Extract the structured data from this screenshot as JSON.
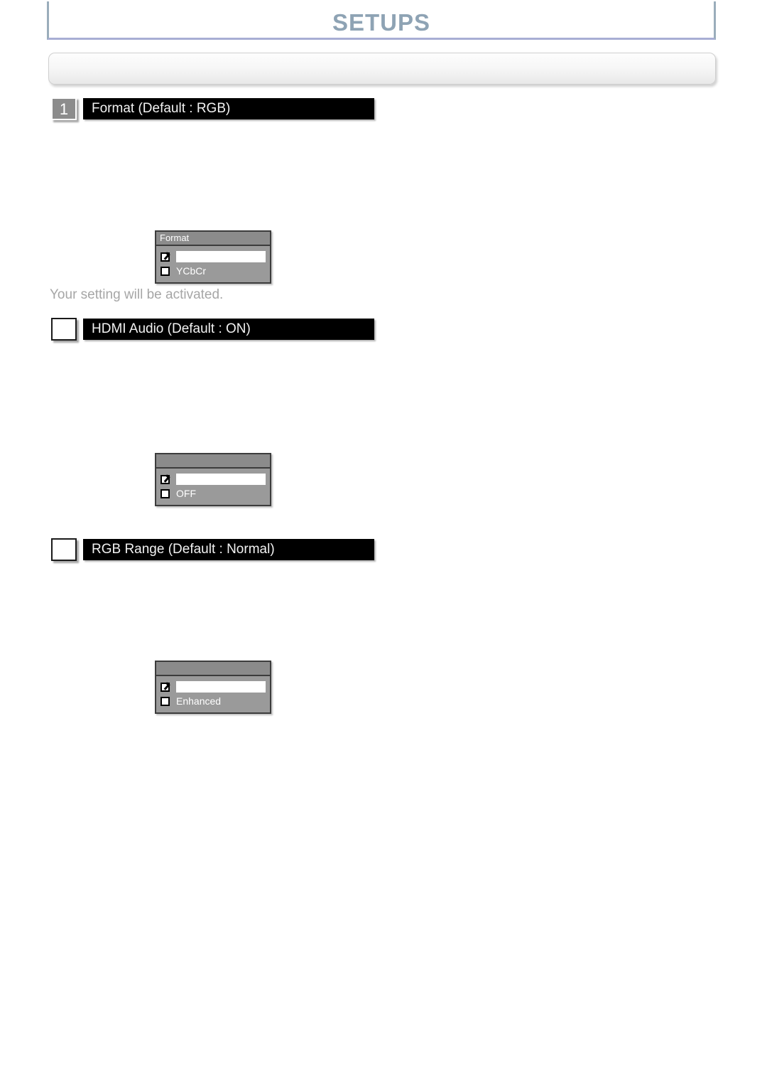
{
  "header": {
    "title": "SETUPS"
  },
  "subbar": {
    "text": ""
  },
  "sections": [
    {
      "badge": "1",
      "badge_style": "filled",
      "title": "Format (Default : RGB)",
      "note": "Your setting will be activated.",
      "dialog": {
        "title": "Format",
        "options": [
          {
            "label": "",
            "checked": true,
            "highlighted": true
          },
          {
            "label": "YCbCr",
            "checked": false,
            "highlighted": false
          }
        ]
      }
    },
    {
      "badge": "",
      "badge_style": "empty",
      "title": "HDMI Audio (Default : ON)",
      "note": "",
      "dialog": {
        "title": "",
        "options": [
          {
            "label": "",
            "checked": true,
            "highlighted": true
          },
          {
            "label": "OFF",
            "checked": false,
            "highlighted": false
          }
        ]
      }
    },
    {
      "badge": "",
      "badge_style": "empty",
      "title": "RGB Range (Default : Normal)",
      "note": "",
      "dialog": {
        "title": "",
        "options": [
          {
            "label": "",
            "checked": true,
            "highlighted": true
          },
          {
            "label": "Enhanced",
            "checked": false,
            "highlighted": false
          }
        ]
      }
    }
  ]
}
